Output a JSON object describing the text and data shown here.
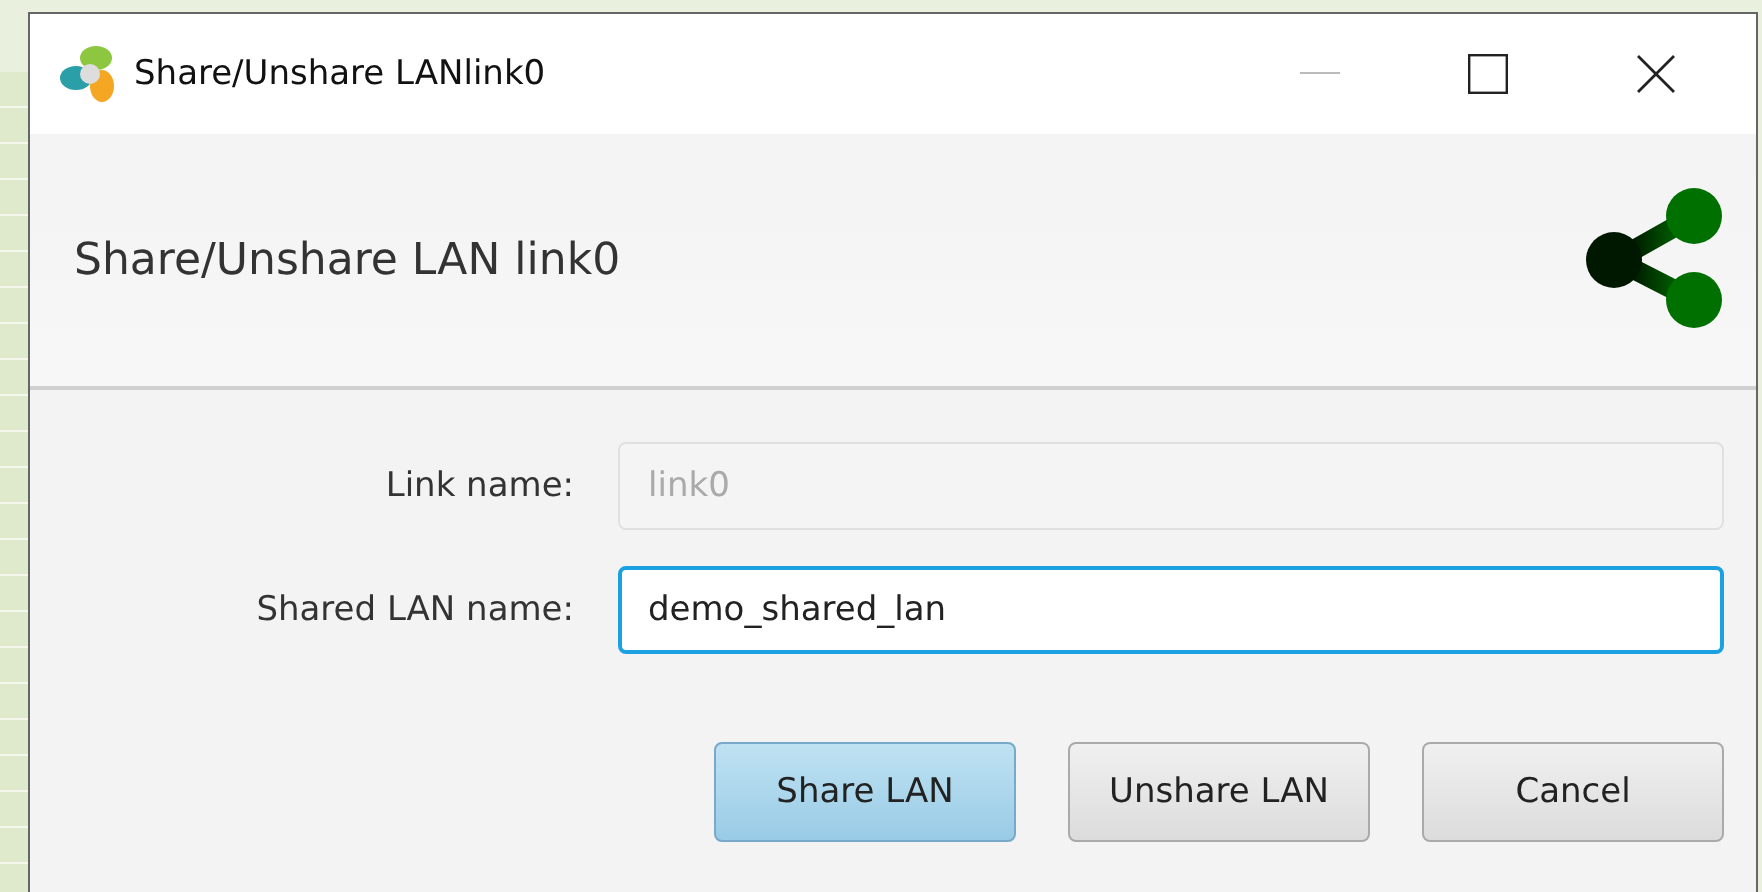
{
  "window": {
    "title": "Share/Unshare LANlink0"
  },
  "header": {
    "title": "Share/Unshare LAN link0"
  },
  "fields": [
    {
      "label": "Link name:",
      "value": "link0",
      "disabled": true,
      "focused": false
    },
    {
      "label": "Shared LAN name:",
      "value": "demo_shared_lan",
      "disabled": false,
      "focused": true
    }
  ],
  "buttons": [
    {
      "label": "Share LAN",
      "default": true
    },
    {
      "label": "Unshare LAN",
      "default": false
    },
    {
      "label": "Cancel",
      "default": false
    }
  ]
}
